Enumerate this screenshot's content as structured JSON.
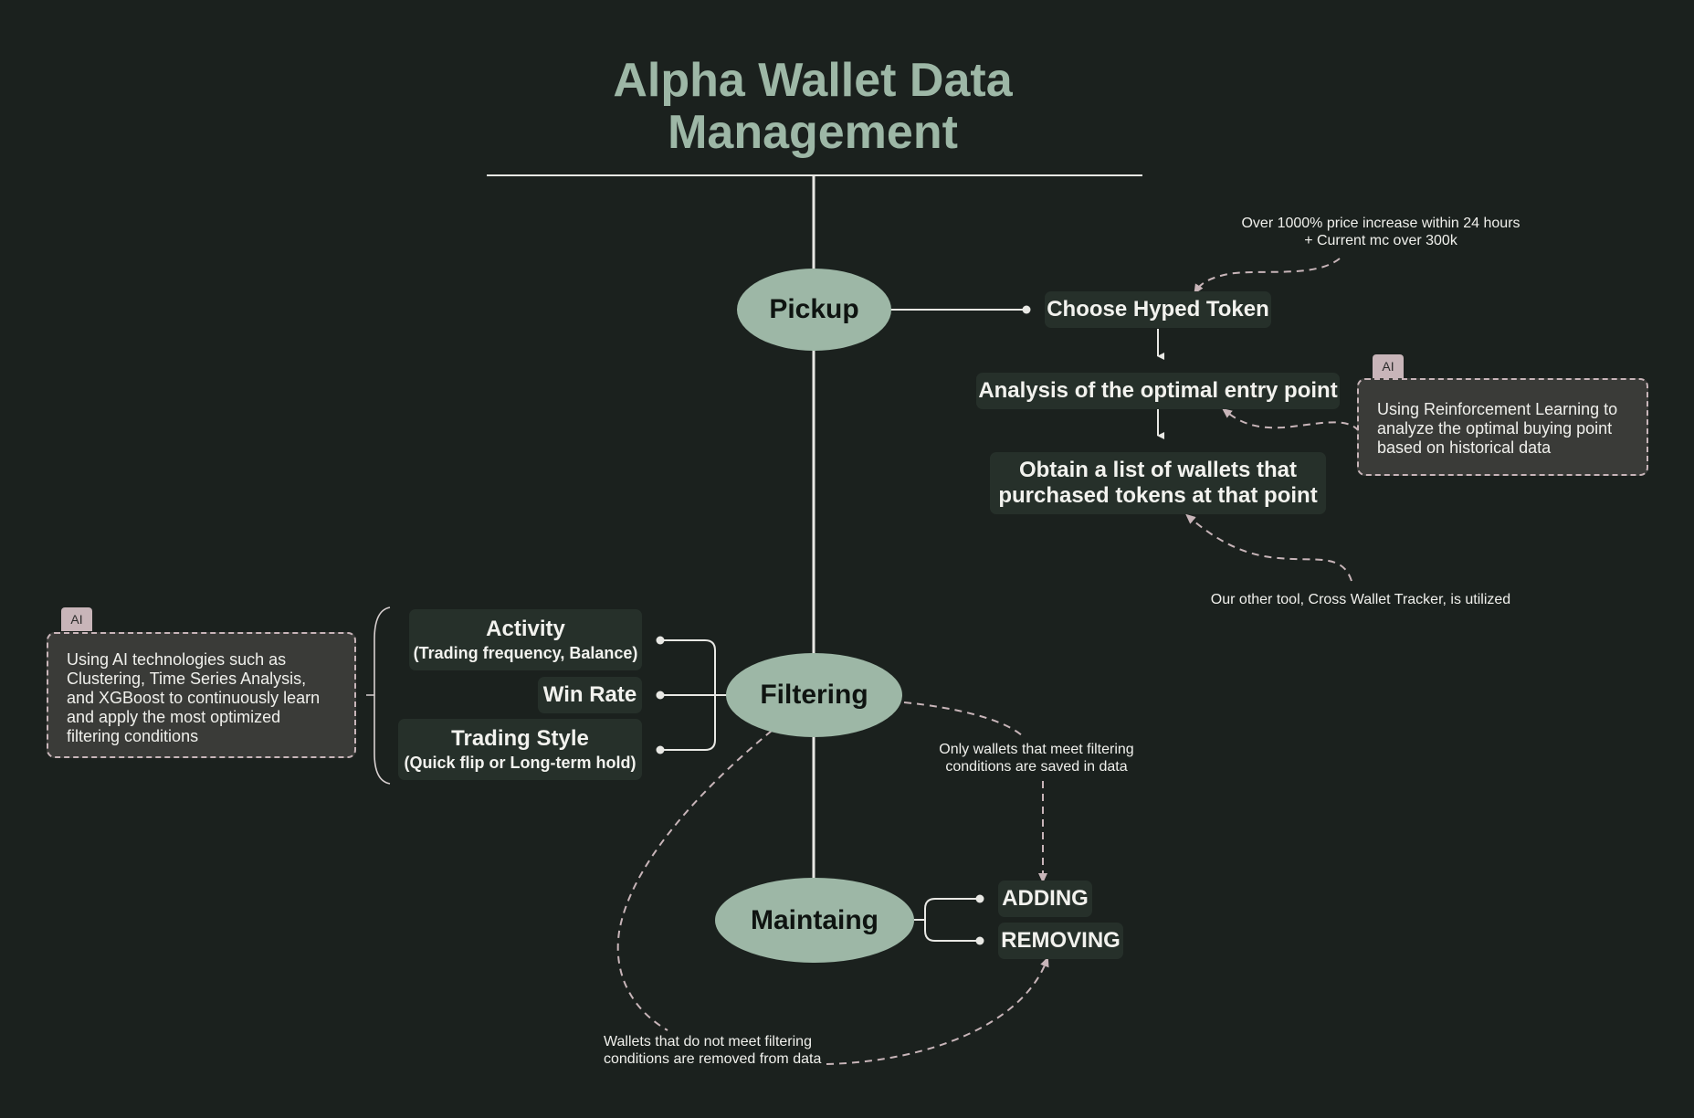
{
  "title": "Alpha Wallet Data Management",
  "title_lines": [
    "Alpha Wallet Data",
    "Management"
  ],
  "colors": {
    "background": "#1b211e",
    "accent": "#9db7a6",
    "node_fill": "#26302a",
    "ai_box_fill": "#3a3b38",
    "dashed_connector": "#c8b5b9"
  },
  "stages": {
    "pickup": {
      "label": "Pickup",
      "steps": [
        {
          "label": "Choose Hyped Token"
        },
        {
          "label": "Analysis of the optimal entry point"
        },
        {
          "label": "Obtain a list of wallets that purchased tokens at that point",
          "lines": [
            "Obtain a list of wallets that",
            "purchased tokens at that point"
          ]
        }
      ],
      "annotations": {
        "criteria": [
          "Over 1000% price increase within 24 hours",
          "+ Current mc over 300k"
        ],
        "tool_note": "Our other tool, Cross Wallet Tracker, is utilized"
      },
      "ai_box": {
        "tag": "AI",
        "text": "Using Reinforcement Learning to analyze the optimal buying point based on historical data"
      }
    },
    "filtering": {
      "label": "Filtering",
      "criteria": [
        {
          "label": "Activity",
          "sub": "(Trading frequency, Balance)"
        },
        {
          "label": "Win Rate",
          "sub": ""
        },
        {
          "label": "Trading Style",
          "sub": "(Quick flip or Long-term hold)"
        }
      ],
      "ai_box": {
        "tag": "AI",
        "text": "Using AI technologies such as Clustering, Time Series Analysis, and XGBoost to continuously learn and apply the most optimized filtering conditions"
      },
      "annotation_saved": [
        "Only wallets that meet filtering",
        "conditions are saved in data"
      ]
    },
    "maintaining": {
      "label": "Maintaing",
      "actions": [
        {
          "label": "ADDING"
        },
        {
          "label": "REMOVING"
        }
      ],
      "annotation_removed": [
        "Wallets that do not meet filtering",
        "conditions are removed from data"
      ]
    }
  }
}
